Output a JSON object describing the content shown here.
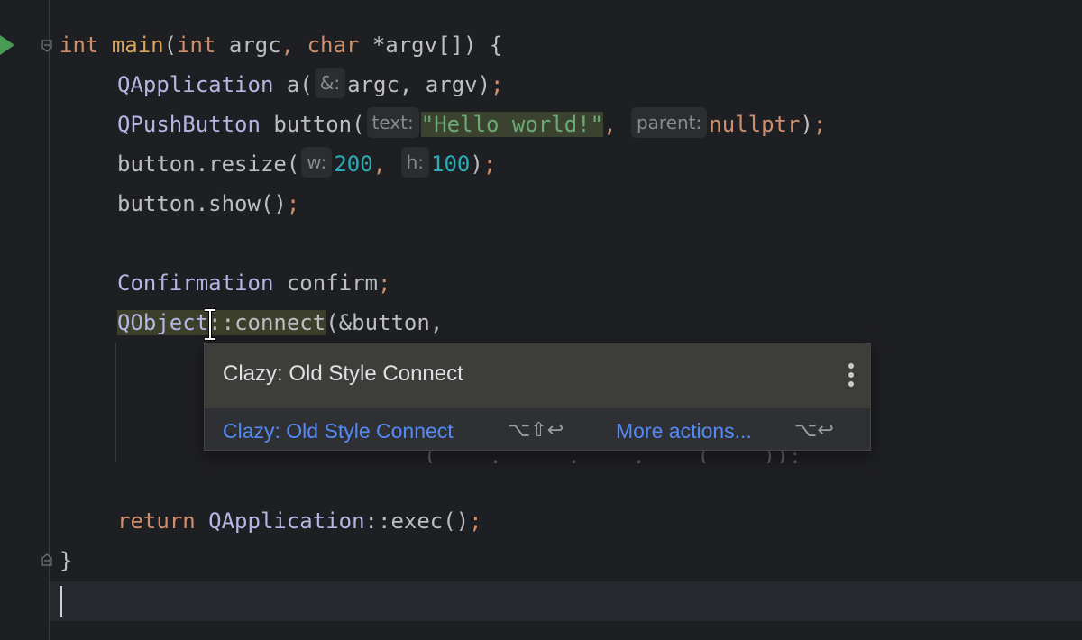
{
  "code": {
    "l1": {
      "kw1": "int",
      "fn": "main",
      "p1": "(",
      "kw2": "int",
      "arg1": " argc",
      "comma": ",",
      "kw3": "char",
      "arg2": " *argv[]) {"
    },
    "l2": {
      "cls": "QApplication",
      "var": " a(",
      "hint": "&:",
      "args": "argc, argv)",
      "semi": ";"
    },
    "l3": {
      "cls": "QPushButton",
      "var": " button(",
      "hint1": "text:",
      "str": "\"Hello world!\"",
      "comma": ",",
      "hint2": "parent:",
      "kw": "nullptr",
      "end": ")",
      "semi": ";"
    },
    "l4": {
      "obj": "button.resize(",
      "hint1": "w:",
      "n1": "200",
      "comma": ",",
      "hint2": "h:",
      "n2": "100",
      "end": ")",
      "semi": ";"
    },
    "l5": {
      "text": "button.show()",
      "semi": ";"
    },
    "l7": {
      "cls": "Confirmation",
      "var": " confirm",
      "semi": ";"
    },
    "l8": {
      "cls": "QObject",
      "sep": "::",
      "fn": "connect",
      "rest": "(&button,",
      "comma": ""
    },
    "l10": {
      "kw": "return",
      "cls": " QApplication",
      "sep": "::",
      "fn": "exec",
      "rest": "()",
      "semi": ";"
    },
    "l11": {
      "text": "}"
    },
    "ghost": "(    ,     ,    ,    (    ));"
  },
  "popup": {
    "title": "Clazy: Old Style Connect",
    "action_label": "Clazy: Old Style Connect",
    "action_shortcut": "⌥⇧↩",
    "more_label": "More actions...",
    "more_shortcut": "⌥↩"
  },
  "icons": {
    "run": "run-gutter-icon",
    "fold": "fold-icon",
    "more": "more-vertical-icon",
    "cursor": "text-cursor-icon"
  },
  "colors": {
    "background": "#1e1f22",
    "keyword": "#cf8e6d",
    "string": "#6aab73",
    "number": "#2aacb8",
    "link": "#548af7"
  }
}
